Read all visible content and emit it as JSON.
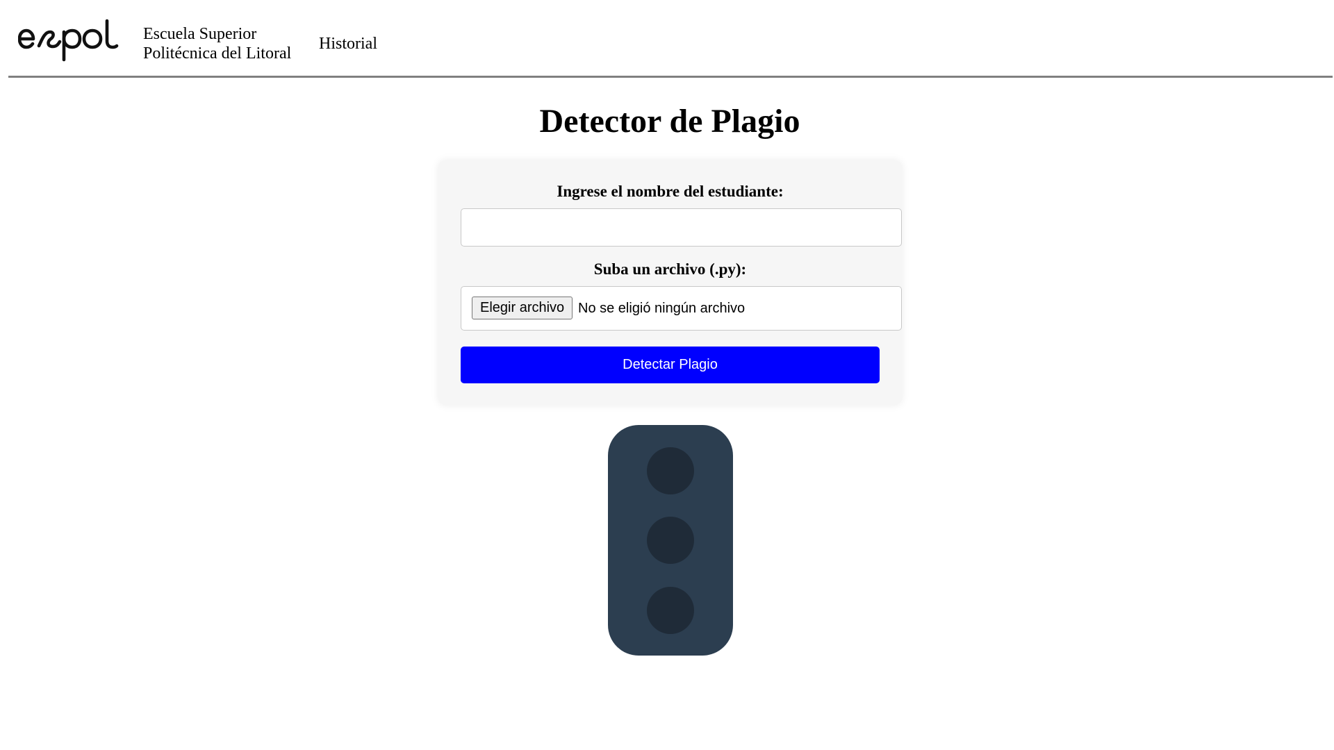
{
  "header": {
    "logo_text": "espol",
    "school_line1": "Escuela Superior",
    "school_line2": "Politécnica del Litoral",
    "nav_historial": "Historial"
  },
  "main": {
    "title": "Detector de Plagio",
    "form": {
      "name_label": "Ingrese el nombre del estudiante:",
      "name_value": "",
      "file_label": "Suba un archivo (.py):",
      "file_button": "Elegir archivo",
      "file_status": "No se eligió ningún archivo",
      "submit_label": "Detectar Plagio"
    },
    "traffic_light": {
      "lights": [
        "off",
        "off",
        "off"
      ],
      "housing_color": "#2c3e50",
      "off_color": "#1f2b38"
    }
  },
  "colors": {
    "accent": "#0000ff",
    "divider": "#808080",
    "card_bg": "#f6f6f6"
  }
}
